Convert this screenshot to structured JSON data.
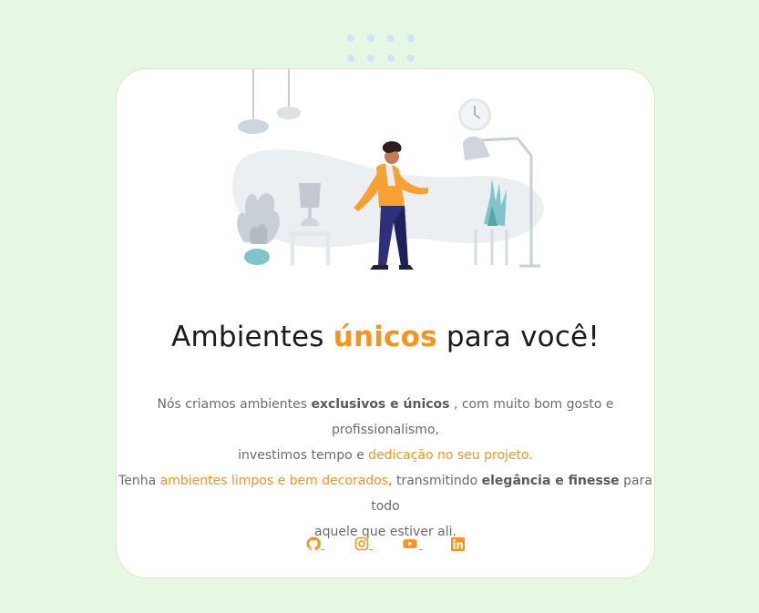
{
  "headline": {
    "before": "Ambientes ",
    "accent": "únicos",
    "after": " para você!"
  },
  "intro": {
    "l1_a": "Nós criamos ambientes ",
    "l1_b": "exclusivos e únicos",
    "l1_c": " , com muito bom gosto e profissionalismo,",
    "l2_a": "investimos tempo e ",
    "l2_b": "dedicação no seu projeto.",
    "l3_a": "Tenha ",
    "l3_b": "ambientes limpos e bem decorados",
    "l3_c": ", transmitindo ",
    "l3_d": "elegância e finesse",
    "l3_e": " para todo",
    "l4_a": "aquele que estiver ali."
  },
  "socials": [
    {
      "icon": "github-icon"
    },
    {
      "icon": "instagram-icon"
    },
    {
      "icon": "youtube-icon"
    },
    {
      "icon": "linkedin-icon"
    }
  ],
  "colors": {
    "accent": "#f7941d",
    "background": "#e6f7e4",
    "card": "#ffffff",
    "text": "#6b6b6b"
  }
}
